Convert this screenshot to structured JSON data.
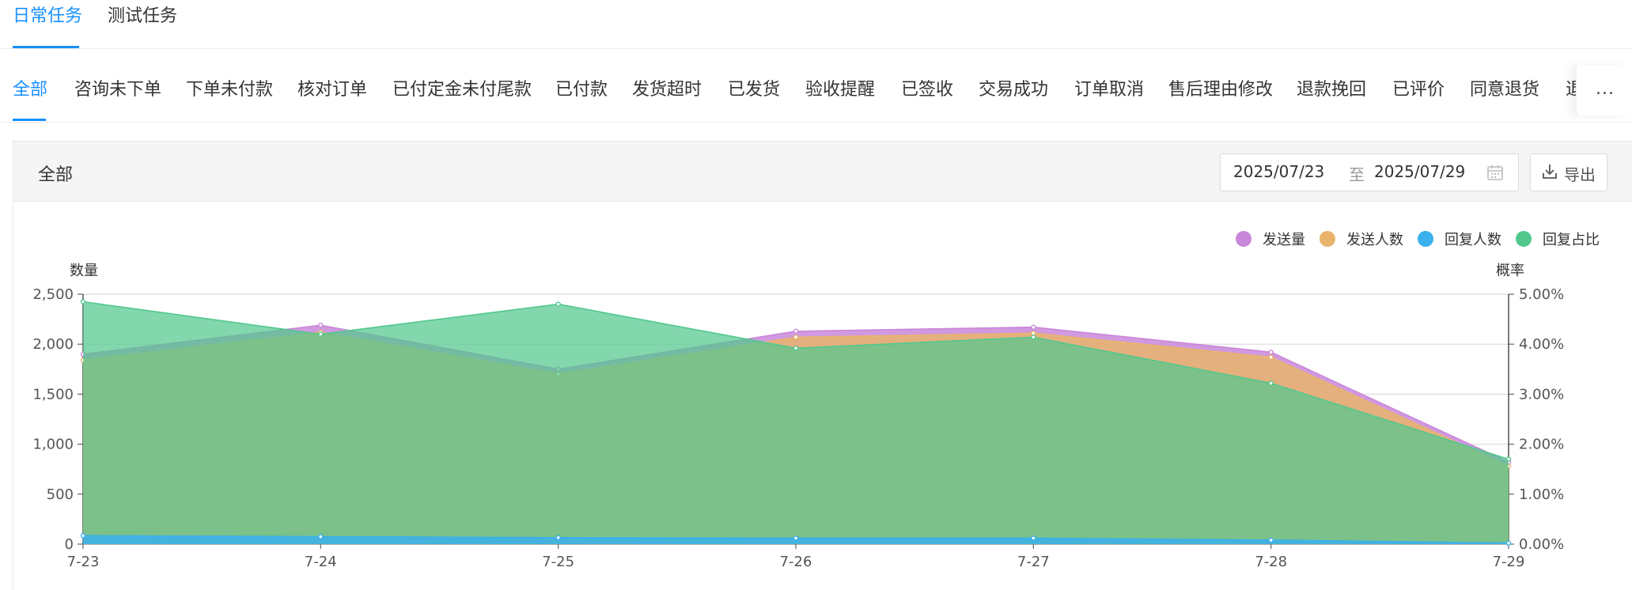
{
  "top_tabs": [
    "日常任务",
    "测试任务"
  ],
  "status_tabs": [
    "全部",
    "咨询未下单",
    "下单未付款",
    "核对订单",
    "已付定金未付尾款",
    "已付款",
    "发货超时",
    "已发货",
    "验收提醒",
    "已签收",
    "交易成功",
    "订单取消",
    "售后理由修改",
    "退款挽回",
    "已评价",
    "同意退货",
    "退"
  ],
  "more_label": "...",
  "panel": {
    "title": "全部",
    "date_start": "2025/07/23",
    "date_sep": "至",
    "date_end": "2025/07/29",
    "export_label": "导出"
  },
  "icons": {
    "calendar": "calendar-icon",
    "export": "download-icon"
  },
  "colors": {
    "accent": "#1890ff",
    "send": "#c987d9",
    "senders": "#e8b46c",
    "replies": "#3ab0ec",
    "ratio": "#52c88e"
  },
  "chart_data": {
    "type": "area",
    "categories": [
      "7-23",
      "7-24",
      "7-25",
      "7-26",
      "7-27",
      "7-28",
      "7-29"
    ],
    "y_left": {
      "label": "数量",
      "min": 0,
      "max": 2500,
      "ticks": [
        "0",
        "500",
        "1,000",
        "1,500",
        "2,000",
        "2,500"
      ]
    },
    "y_right": {
      "label": "概率",
      "min": 0,
      "max": 5,
      "ticks": [
        "0.00%",
        "1.00%",
        "2.00%",
        "3.00%",
        "4.00%",
        "5.00%"
      ]
    },
    "series": [
      {
        "name": "发送量",
        "axis": "left",
        "color": "#c987d9",
        "values": [
          1900,
          2190,
          1750,
          2130,
          2170,
          1920,
          820
        ]
      },
      {
        "name": "发送人数",
        "axis": "left",
        "color": "#e8b46c",
        "values": [
          1840,
          2120,
          1700,
          2070,
          2110,
          1870,
          780
        ]
      },
      {
        "name": "回复人数",
        "axis": "left",
        "color": "#3ab0ec",
        "values": [
          85,
          75,
          65,
          60,
          60,
          40,
          10
        ]
      },
      {
        "name": "回复占比",
        "axis": "right",
        "color": "#52c88e",
        "values": [
          4.85,
          4.2,
          4.8,
          3.92,
          4.14,
          3.22,
          1.7
        ]
      }
    ],
    "grid": true,
    "legend_position": "top-right"
  }
}
